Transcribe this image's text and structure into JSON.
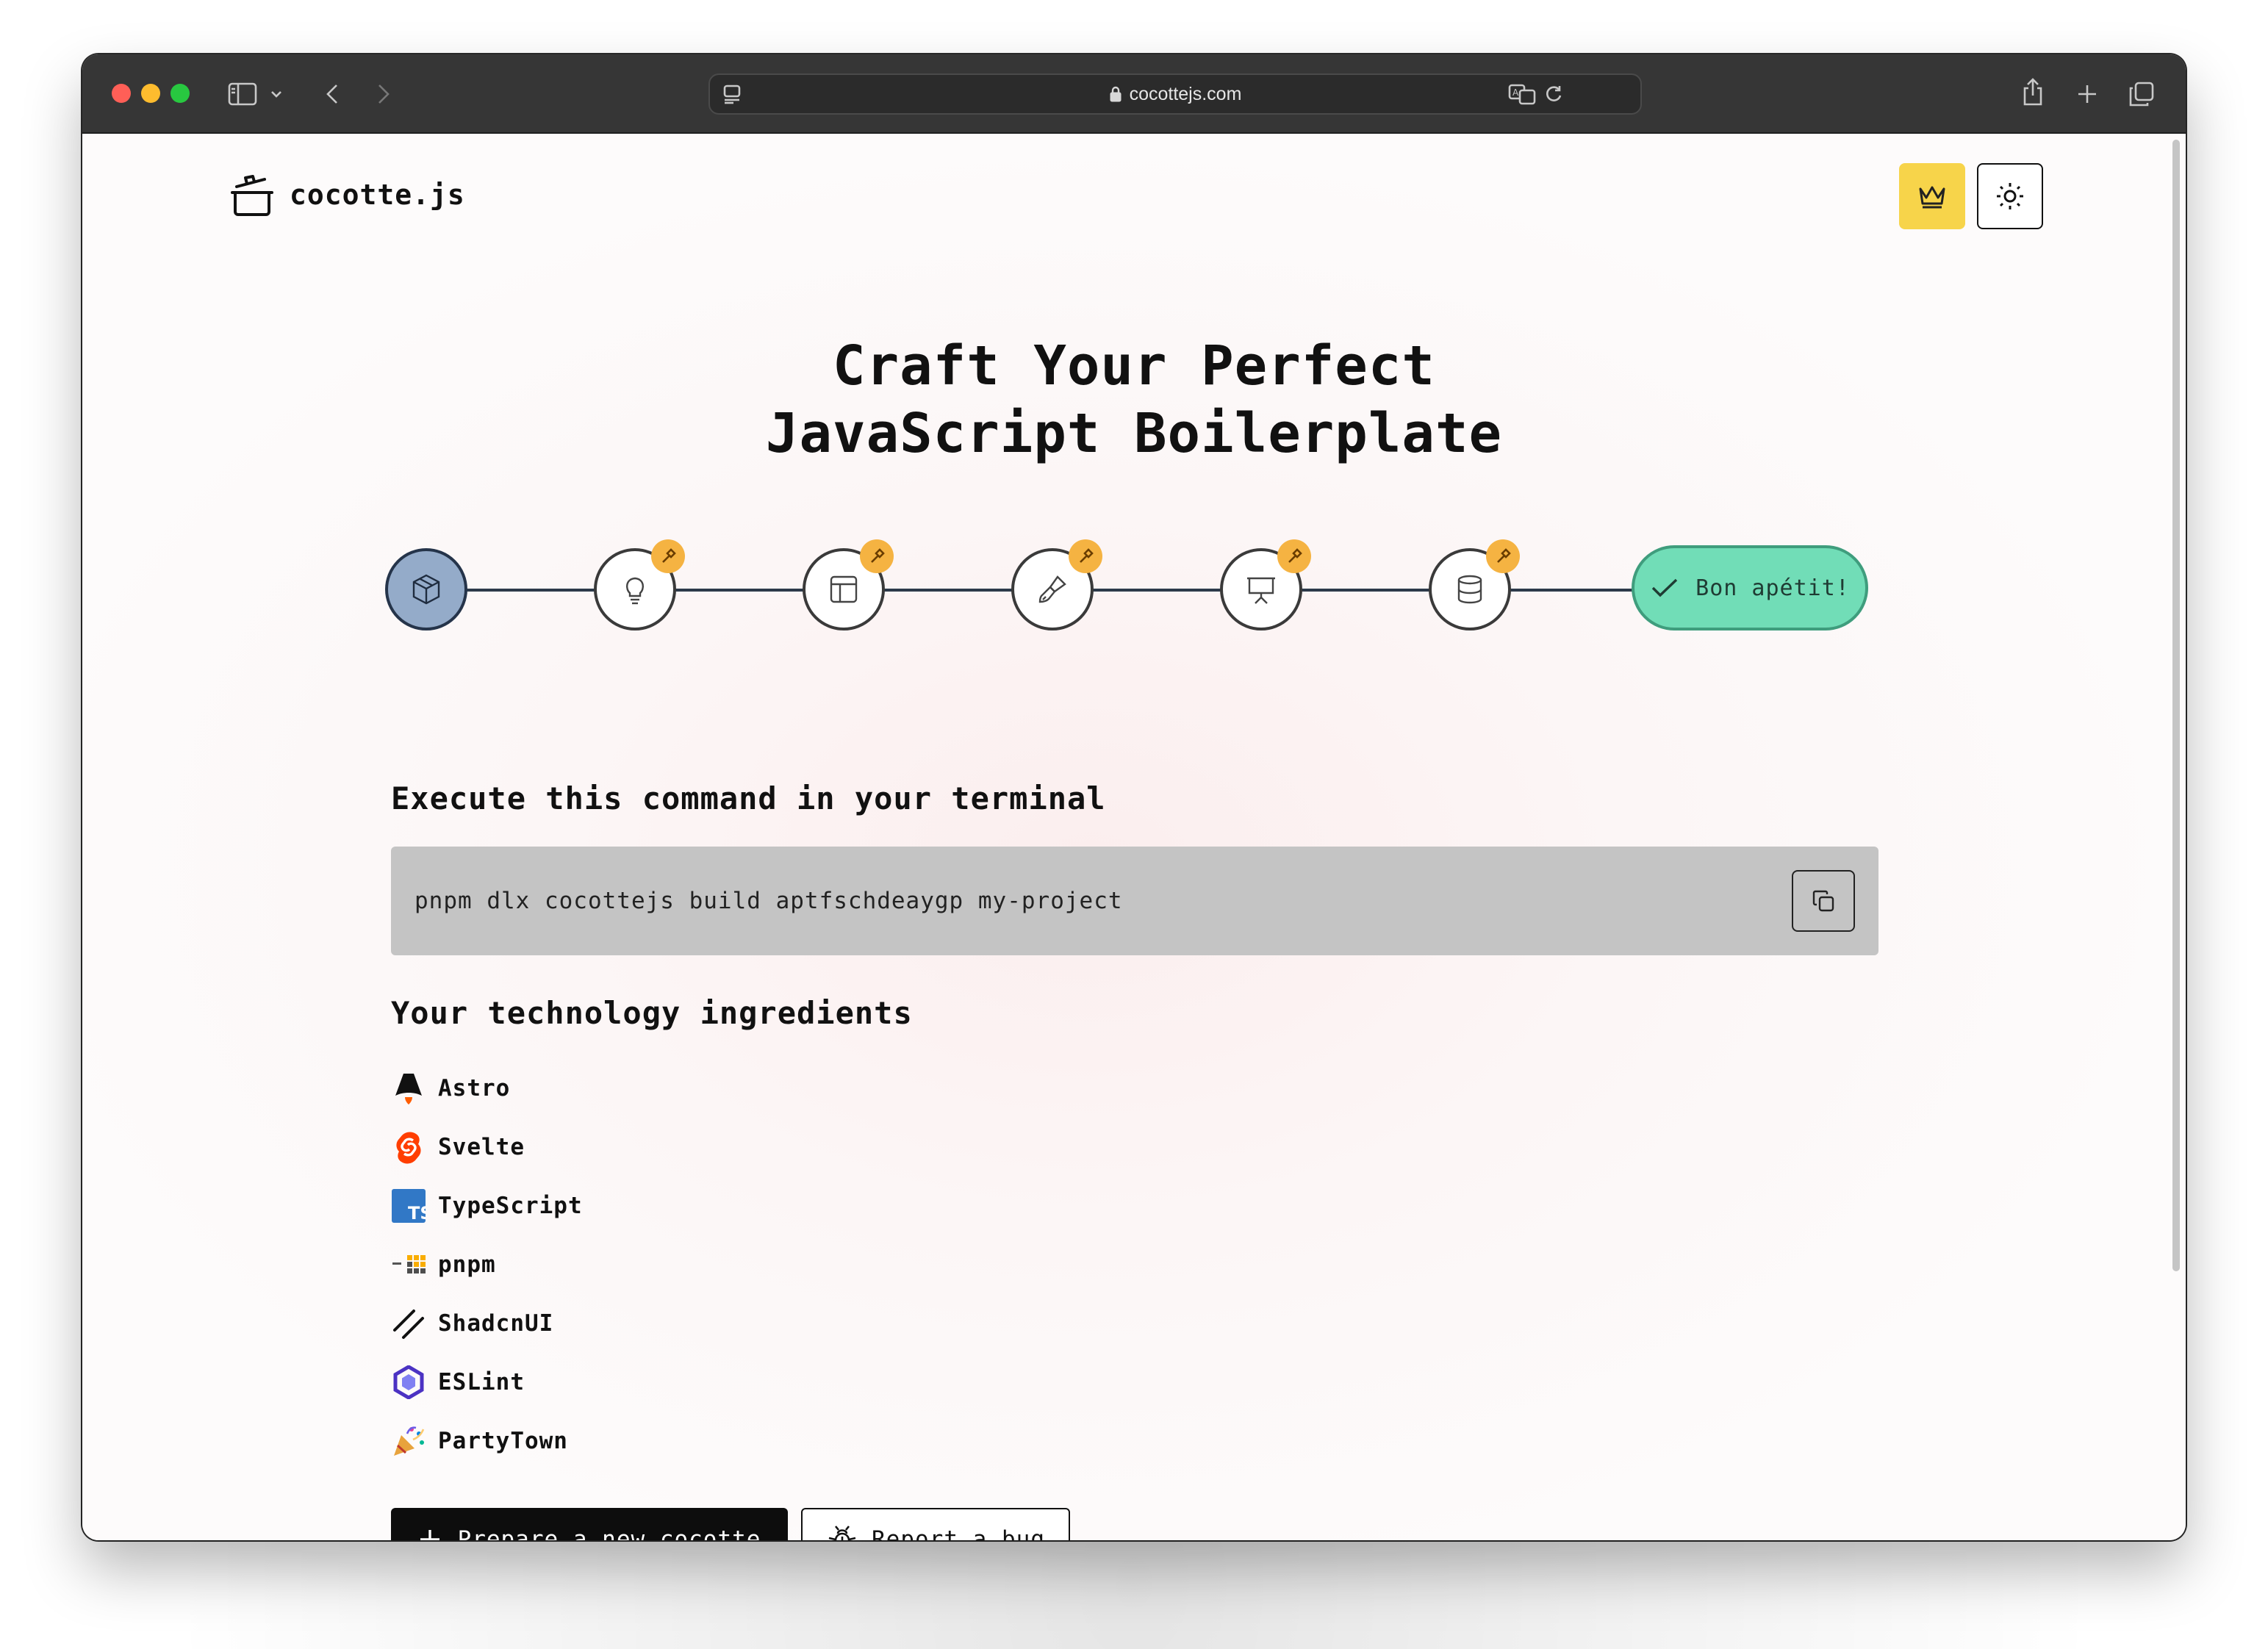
{
  "browser": {
    "url": "cocottejs.com",
    "icons": [
      "sidebar-icon",
      "chevron-down-icon",
      "back-icon",
      "forward-icon",
      "reader-icon",
      "lock-icon",
      "translate-icon",
      "reload-icon",
      "share-icon",
      "new-tab-icon",
      "tabs-overview-icon"
    ]
  },
  "header": {
    "logo_text": "cocotte.js",
    "premium_icon": "crown-icon",
    "theme_icon": "sun-icon",
    "colors": {
      "premium_button": "#f7d44a"
    }
  },
  "hero": {
    "line1": "Craft Your Perfect",
    "line2": "JavaScript Boilerplate"
  },
  "stepper": {
    "steps": [
      {
        "icon": "package-icon",
        "active": true
      },
      {
        "icon": "lightbulb-icon",
        "badge": "hammer-icon"
      },
      {
        "icon": "layout-icon",
        "badge": "hammer-icon"
      },
      {
        "icon": "paintbrush-icon",
        "badge": "hammer-icon"
      },
      {
        "icon": "presentation-icon",
        "badge": "hammer-icon"
      },
      {
        "icon": "database-icon",
        "badge": "hammer-icon"
      }
    ],
    "final_label": "Bon apétit!",
    "final_icon": "check-icon",
    "colors": {
      "active": "#94abc9",
      "final": "#71ddb7",
      "badge": "#f5b342"
    }
  },
  "command": {
    "title": "Execute this command in your terminal",
    "text": "pnpm dlx cocottejs build aptfschdeaygp my-project",
    "copy_icon": "copy-icon"
  },
  "ingredients": {
    "title": "Your technology ingredients",
    "items": [
      {
        "label": "Astro",
        "icon": "astro-icon"
      },
      {
        "label": "Svelte",
        "icon": "svelte-icon"
      },
      {
        "label": "TypeScript",
        "icon": "typescript-icon"
      },
      {
        "label": "pnpm",
        "icon": "pnpm-icon"
      },
      {
        "label": "ShadcnUI",
        "icon": "shadcn-icon"
      },
      {
        "label": "ESLint",
        "icon": "eslint-icon"
      },
      {
        "label": "PartyTown",
        "icon": "partytown-icon"
      }
    ]
  },
  "actions": {
    "primary_label": "Prepare a new cocotte",
    "secondary_label": "Report a bug"
  }
}
